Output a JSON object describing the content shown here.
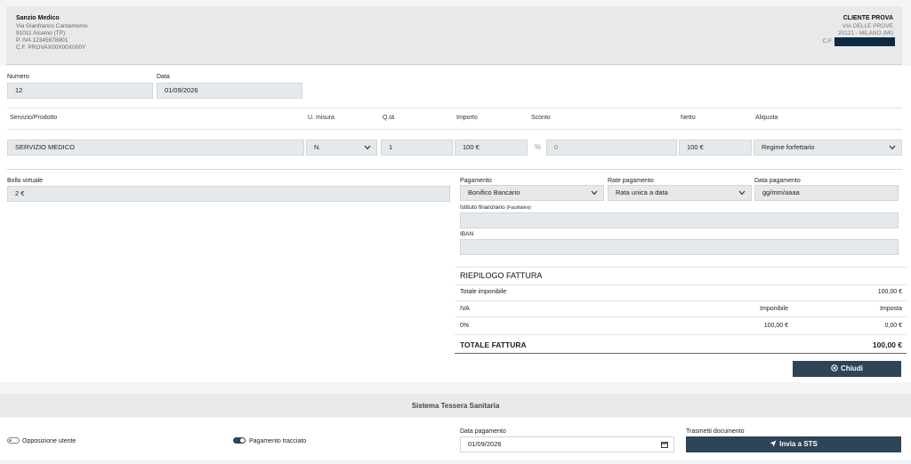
{
  "header": {
    "issuer": {
      "name": "Sanzio Medico",
      "address": "Via Gianfranco Cardamomo",
      "city": "91011 Alcamo (TP)",
      "vat": "P. IVA 12345678901",
      "tax_code": "C.F. PROVAX00X00X000Y"
    },
    "client": {
      "title": "CLIENTE PROVA",
      "address": "VIA DELLE PROVE",
      "city": "20121 - MILANO (MI)",
      "tax_code_label": "C.F."
    }
  },
  "invoice": {
    "number_label": "Numero",
    "number_value": "12",
    "date_label": "Data",
    "date_value": "01/09/2026"
  },
  "line_table": {
    "headers": {
      "service": "Servizio/Prodotto",
      "unit": "U. misura",
      "qty": "Q.tà",
      "amount": "Importo",
      "discount": "Sconto",
      "net": "Netto",
      "rate": "Aliquota"
    },
    "row": {
      "service": "SERVIZIO MEDICO",
      "unit": "N.",
      "qty": "1",
      "amount": "100 €",
      "discount_symbol": "%",
      "discount": "0",
      "net": "100 €",
      "rate": "Regime forfettario"
    }
  },
  "stamp": {
    "label": "Bollo virtuale",
    "value": "2 €"
  },
  "payment": {
    "method_label": "Pagamento",
    "method_value": "Bonifico Bancario",
    "installment_label": "Rate pagamento",
    "installment_value": "Rata unica a data",
    "date_label": "Data pagamento",
    "date_placeholder": "gg/mm/aaaa",
    "bank_label": "Istituto finanziario",
    "bank_optional": "(Facoltativo)",
    "iban_label": "IBAN"
  },
  "summary": {
    "title": "RIEPILOGO FATTURA",
    "taxable_total_label": "Totale imponibile",
    "taxable_total_value": "100,00 €",
    "col_iva": "IVA",
    "col_taxable": "Imponibile",
    "col_tax": "Imposta",
    "row_iva": "0%",
    "row_taxable": "100,00 €",
    "row_tax": "0,00 €",
    "total_label": "TOTALE FATTURA",
    "total_value": "100,00 €",
    "close_button": "Chiudi"
  },
  "sts": {
    "title": "Sistema Tessera Sanitaria",
    "opposition_label": "Opposizione utente",
    "opposition_on": false,
    "traced_label": "Pagamento tracciato",
    "traced_on": true,
    "date_label": "Data pagamento",
    "date_value": "01/09/2026",
    "send_label": "Trasmetti documento",
    "send_button": "Invia a STS"
  },
  "colors": {
    "button": "#2e4457",
    "field": "#e6e9ec",
    "header_bg": "#e8e9ea",
    "redacted": "#0d2a45"
  }
}
